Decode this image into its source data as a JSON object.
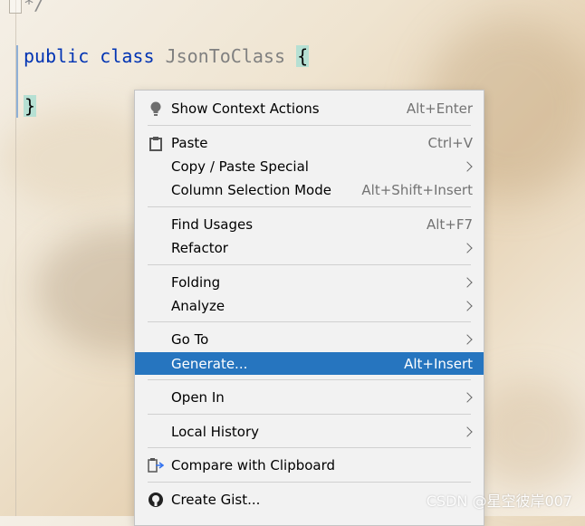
{
  "editor": {
    "comment": "*/",
    "line1": {
      "kw1": "public",
      "kw2": "class",
      "class_name": "JsonToClass",
      "open_brace": "{"
    },
    "line2": {
      "close_brace": "}"
    }
  },
  "menu": {
    "items": [
      {
        "label": "Show Context Actions",
        "shortcut": "Alt+Enter",
        "icon": "lightbulb-icon"
      },
      {
        "label": "Paste",
        "shortcut": "Ctrl+V",
        "icon": "clipboard-icon"
      },
      {
        "label": "Copy / Paste Special",
        "shortcut": ""
      },
      {
        "label": "Column Selection Mode",
        "shortcut": "Alt+Shift+Insert"
      },
      {
        "label": "Find Usages",
        "shortcut": "Alt+F7"
      },
      {
        "label": "Refactor",
        "shortcut": ""
      },
      {
        "label": "Folding",
        "shortcut": ""
      },
      {
        "label": "Analyze",
        "shortcut": ""
      },
      {
        "label": "Go To",
        "shortcut": ""
      },
      {
        "label": "Generate...",
        "shortcut": "Alt+Insert",
        "selected": true
      },
      {
        "label": "Open In",
        "shortcut": ""
      },
      {
        "label": "Local History",
        "shortcut": ""
      },
      {
        "label": "Compare with Clipboard",
        "shortcut": "",
        "icon": "compare-icon"
      },
      {
        "label": "Create Gist...",
        "shortcut": "",
        "icon": "github-icon"
      }
    ]
  },
  "colors": {
    "selection": "#2675bf",
    "keyword": "#0033b3",
    "brace_highlight": "#b6e0d3"
  },
  "watermark": "CSDN @星空彼岸007"
}
